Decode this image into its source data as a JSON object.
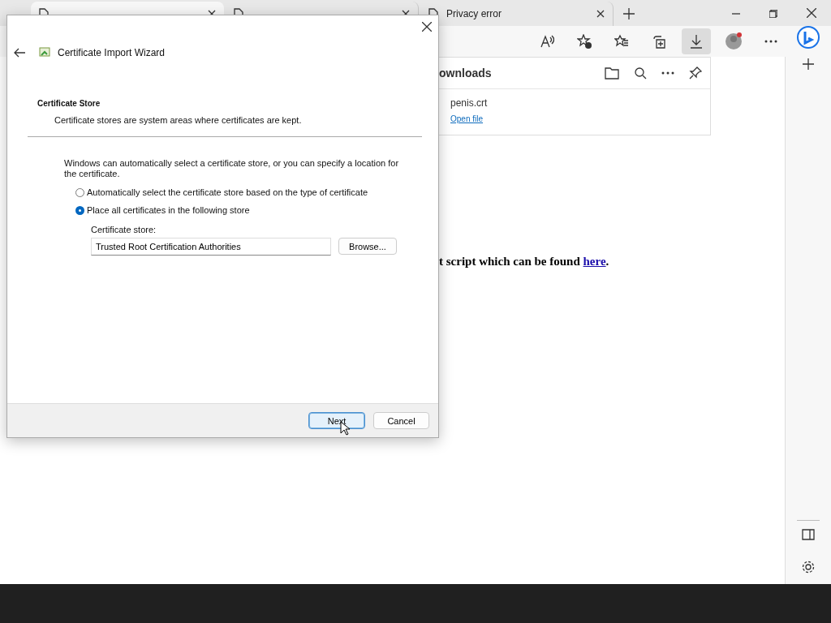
{
  "tabs": [
    {
      "selected": true
    },
    {
      "selected": false
    },
    {
      "title": "Privacy error",
      "selected": false
    }
  ],
  "downloads": {
    "title": "ownloads",
    "items": [
      {
        "file": "penis.crt",
        "action": "Open file"
      }
    ]
  },
  "page": {
    "text": "t script which can be found ",
    "link": "here",
    "after": "."
  },
  "dialog": {
    "title": "Certificate Import Wizard",
    "heading": "Certificate Store",
    "subheading": "Certificate stores are system areas where certificates are kept.",
    "intro": "Windows can automatically select a certificate store, or you can specify a location for the certificate.",
    "options": [
      {
        "label": "Automatically select the certificate store based on the type of certificate",
        "selected": false
      },
      {
        "label": "Place all certificates in the following store",
        "selected": true
      }
    ],
    "store_label": "Certificate store:",
    "store_value": "Trusted Root Certification Authorities",
    "browse": "Browse...",
    "buttons": [
      {
        "label": "Next",
        "kind": "primary"
      },
      {
        "label": "Cancel",
        "kind": "secondary"
      }
    ]
  }
}
